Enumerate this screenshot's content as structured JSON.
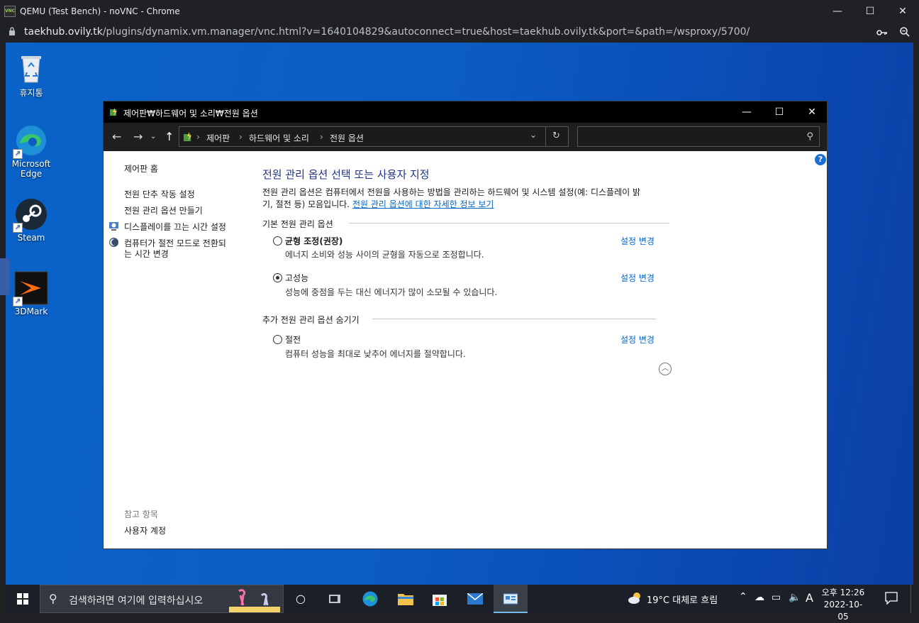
{
  "browser": {
    "app_icon_text": "VNC",
    "title": "QEMU (Test Bench) - noVNC - Chrome",
    "url_host": "taekhub.ovily.tk",
    "url_path": "/plugins/dynamix.vm.manager/vnc.html?v=1640104829&autoconnect=true&host=taekhub.ovily.tk&port=&path=/wsproxy/5700/",
    "controls": {
      "minimize": "—",
      "maximize": "☐",
      "close": "✕"
    },
    "key_icon": "key-icon",
    "zoom_icon": "zoom-icon"
  },
  "desktop": {
    "icons": [
      {
        "label": "휴지통",
        "icon": "recycle-bin-icon"
      },
      {
        "label": "Microsoft Edge",
        "icon": "edge-icon"
      },
      {
        "label": "Steam",
        "icon": "steam-icon"
      },
      {
        "label": "3DMark",
        "icon": "3dmark-icon"
      }
    ]
  },
  "window": {
    "title": "제어판₩하드웨어 및 소리₩전원 옵션",
    "controls": {
      "minimize": "—",
      "maximize": "☐",
      "close": "✕"
    },
    "breadcrumb": [
      "제어판",
      "하드웨어 및 소리",
      "전원 옵션"
    ],
    "search_placeholder": "",
    "help": "?"
  },
  "sidebar": {
    "home": "제어판 홈",
    "links": [
      "전원 단추 작동 설정",
      "전원 관리 옵션 만들기",
      "디스플레이를 끄는 시간 설정",
      "컴퓨터가 절전 모드로 전환되",
      "는 시간 변경"
    ],
    "see_also_header": "참고 항목",
    "see_also": [
      "사용자 계정"
    ]
  },
  "main": {
    "heading": "전원 관리 옵션 선택 또는 사용자 지정",
    "desc_line1": "전원 관리 옵션은 컴퓨터에서 전원을 사용하는 방법을 관리하는 하드웨어 및 시스템 설정(예: 디스플레이 밝",
    "desc_line2": "기, 절전 등) 모음입니다. ",
    "desc_link": "전원 관리 옵션에 대한 자세한 정보 보기",
    "basic_header": "기본 전원 관리 옵션",
    "extra_header": "추가 전원 관리 옵션 숨기기",
    "change_label": "설정 변경",
    "plans": [
      {
        "name": "균형 조정(권장)",
        "desc": "에너지 소비와 성능 사이의 균형을 자동으로 조정합니다.",
        "selected": false
      },
      {
        "name": "고성능",
        "desc": "성능에 중점을 두는 대신 에너지가 많이 소모될 수 있습니다.",
        "selected": true
      },
      {
        "name": "절전",
        "desc": "컴퓨터 성능을 최대로 낮추어 에너지를 절약합니다.",
        "selected": false
      }
    ]
  },
  "taskbar": {
    "search_placeholder": "검색하려면 여기에 입력하십시오",
    "weather": "19°C  대체로 흐림",
    "ime": "A",
    "time_ampm": "오후 12:26",
    "date": "2022-10-05"
  }
}
